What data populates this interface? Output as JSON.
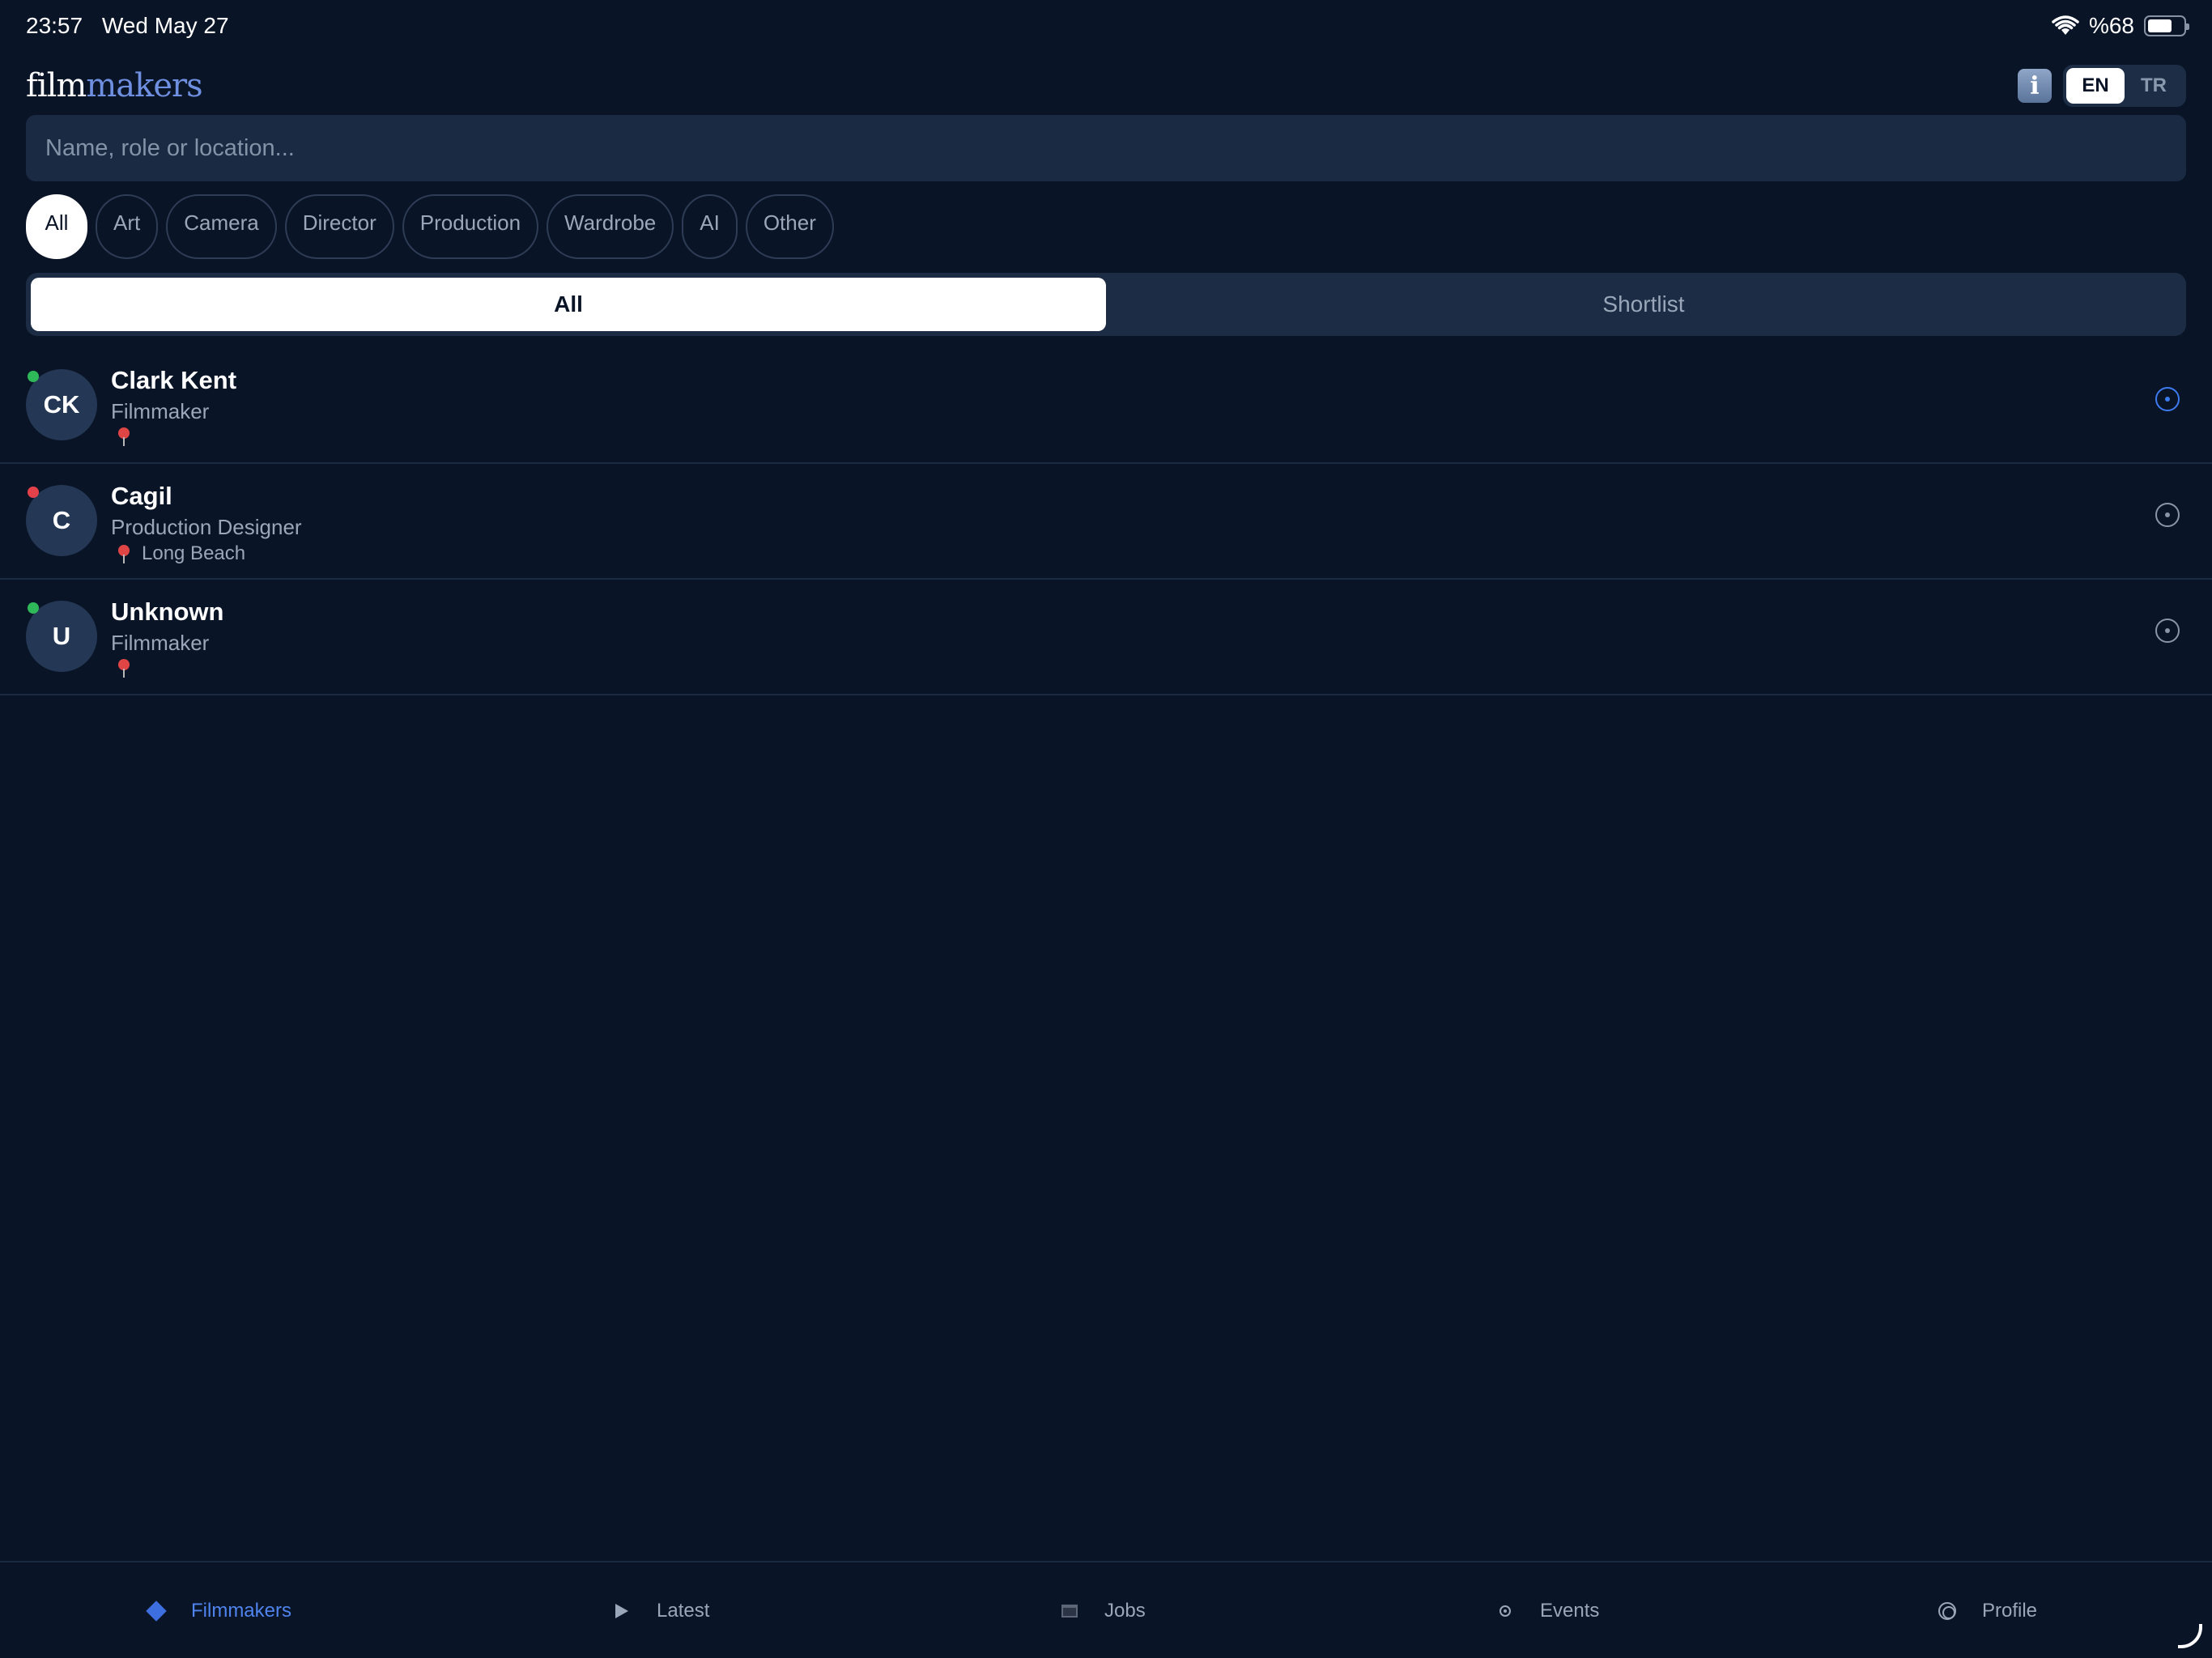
{
  "status_bar": {
    "time": "23:57",
    "date": "Wed May 27",
    "battery": "%68",
    "battery_level": 0.68
  },
  "header": {
    "logo_part1": "film",
    "logo_part2": "makers",
    "info_label": "i",
    "languages": [
      {
        "label": "EN",
        "active": true
      },
      {
        "label": "TR",
        "active": false
      }
    ]
  },
  "search": {
    "value": "",
    "placeholder": "Name, role or location..."
  },
  "filters": [
    {
      "label": "All",
      "active": true
    },
    {
      "label": "Art",
      "active": false
    },
    {
      "label": "Camera",
      "active": false
    },
    {
      "label": "Director",
      "active": false
    },
    {
      "label": "Production",
      "active": false
    },
    {
      "label": "Wardrobe",
      "active": false
    },
    {
      "label": "AI",
      "active": false
    },
    {
      "label": "Other",
      "active": false
    }
  ],
  "segments": [
    {
      "label": "All",
      "active": true
    },
    {
      "label": "Shortlist",
      "active": false
    }
  ],
  "people": [
    {
      "initials": "CK",
      "name": "Clark Kent",
      "role": "Filmmaker",
      "location": "",
      "status_color": "#2fb85a",
      "action_active": true
    },
    {
      "initials": "C",
      "name": "Cagil",
      "role": "Production Designer",
      "location": "Long Beach",
      "status_color": "#e5414b",
      "action_active": false
    },
    {
      "initials": "U",
      "name": "Unknown",
      "role": "Filmmaker",
      "location": "",
      "status_color": "#2fb85a",
      "action_active": false
    }
  ],
  "tabs": [
    {
      "label": "Filmmakers",
      "icon": "diamond-icon",
      "active": true
    },
    {
      "label": "Latest",
      "icon": "play-icon",
      "active": false
    },
    {
      "label": "Jobs",
      "icon": "briefcase-icon",
      "active": false
    },
    {
      "label": "Events",
      "icon": "events-icon",
      "active": false
    },
    {
      "label": "Profile",
      "icon": "profile-icon",
      "active": false
    }
  ],
  "colors": {
    "background": "#0a1427",
    "accent": "#4f84ee"
  }
}
